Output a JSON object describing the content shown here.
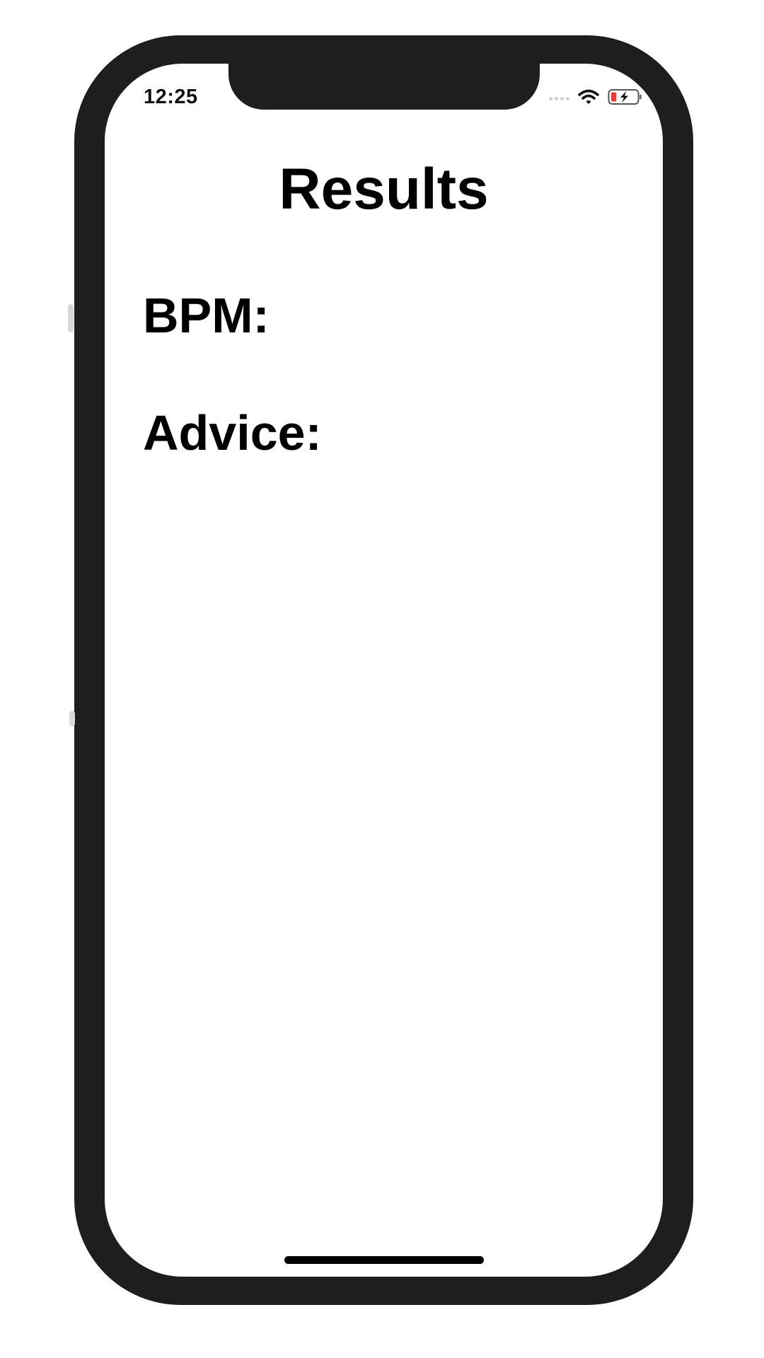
{
  "status_bar": {
    "time": "12:25",
    "icons": [
      "signal-icon",
      "wifi-icon",
      "battery-charging-icon"
    ],
    "battery_color": "#e53935"
  },
  "screen": {
    "title": "Results",
    "bpm_label": "BPM:",
    "advice_label": "Advice:"
  }
}
